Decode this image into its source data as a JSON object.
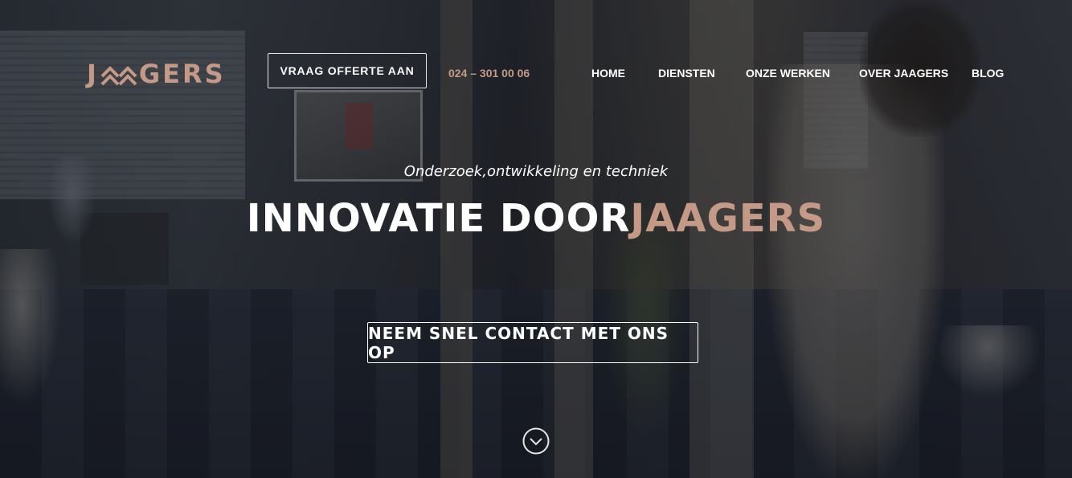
{
  "header": {
    "logo_text": "JAAGERS",
    "offerte_button": "VRAAG OFFERTE AAN",
    "phone": "024 – 301 00 06"
  },
  "nav": {
    "items": [
      {
        "label": "HOME"
      },
      {
        "label": "DIENSTEN"
      },
      {
        "label": "ONZE WERKEN"
      },
      {
        "label": "OVER JAAGERS"
      },
      {
        "label": "BLOG"
      }
    ]
  },
  "hero": {
    "subtitle": "Onderzoek,ontwikkeling en techniek",
    "headline_main": "INNOVATIE DOOR",
    "headline_accent": "JAAGERS",
    "cta_label": "NEEM SNEL CONTACT MET ONS OP"
  },
  "colors": {
    "accent": "#c49a86",
    "text": "#ffffff"
  },
  "icons": {
    "logo_mark": "double-chevron-up-icon",
    "scroll": "chevron-down-circle-icon"
  }
}
